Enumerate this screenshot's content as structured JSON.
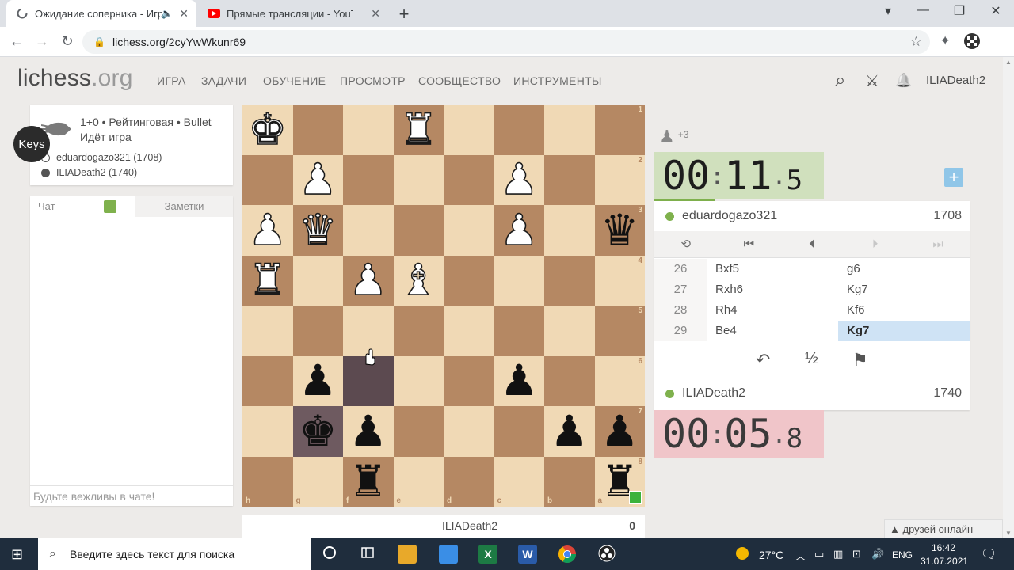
{
  "browser": {
    "tabs": [
      {
        "title": "Ожидание соперника - Игр",
        "active": true,
        "audio_icon": "🔈",
        "close": "✕"
      },
      {
        "title": "Прямые трансляции - YouTube",
        "active": false,
        "close": "✕"
      }
    ],
    "new_tab": "+",
    "window_controls": {
      "minimize": "—",
      "maximize": "❐",
      "close": "✕",
      "profile": "▾"
    },
    "url": "lichess.org/2cyYwWkunr69",
    "nav": {
      "back": "←",
      "forward": "→",
      "reload": "↻"
    },
    "star": "☆",
    "extension_icon": "✦",
    "lock_icon": "🔒"
  },
  "site": {
    "logo_main": "lichess",
    "logo_suffix": ".org",
    "nav": [
      "ИГРА",
      "ЗАДАЧИ",
      "ОБУЧЕНИЕ",
      "ПРОСМОТР",
      "СООБЩЕСТВО",
      "ИНСТРУМЕНТЫ"
    ],
    "icons": {
      "search": "⌕",
      "swords": "⚔",
      "bell": "🔔"
    },
    "username": "ILIADeath2"
  },
  "game_info": {
    "line1": "1+0 • Рейтинговая • Bullet",
    "line2": "Идёт игра",
    "white_player": "eduardogazo321 (1708)",
    "black_player": "ILIADeath2 (1740)",
    "keys_label": "Keys"
  },
  "chat": {
    "tab_chat": "Чат",
    "tab_notes": "Заметки",
    "placeholder": "Будьте вежливы в чате!"
  },
  "board": {
    "orientation": "black",
    "files_bottom": [
      "h",
      "g",
      "f",
      "e",
      "d",
      "c",
      "b",
      "a"
    ],
    "ranks_right": [
      "1",
      "2",
      "3",
      "4",
      "5",
      "6",
      "7",
      "8"
    ],
    "rows": [
      [
        "wK",
        "",
        "",
        "wR",
        "",
        "",
        "",
        ""
      ],
      [
        "",
        "wP",
        "",
        "",
        "",
        "wP",
        "",
        ""
      ],
      [
        "wP",
        "wQ",
        "",
        "",
        "",
        "wP",
        "",
        "bQ"
      ],
      [
        "wR",
        "",
        "wP",
        "wB",
        "",
        "",
        "",
        ""
      ],
      [
        "",
        "",
        "",
        "",
        "",
        "",
        "",
        ""
      ],
      [
        "",
        "bP",
        "",
        "",
        "",
        "bP",
        "",
        ""
      ],
      [
        "",
        "bK",
        "bP",
        "",
        "",
        "",
        "bP",
        "bP"
      ],
      [
        "",
        "",
        "bR",
        "",
        "",
        "",
        "",
        "bR"
      ]
    ],
    "highlighted": [
      [
        5,
        2
      ],
      [
        6,
        1
      ]
    ]
  },
  "under_board": {
    "name": "ILIADeath2",
    "score": "0"
  },
  "right": {
    "material": {
      "icon": "♟",
      "diff": "+3"
    },
    "clock_top": {
      "min": "00",
      "sec": "11",
      "tenth": "5"
    },
    "clock_bottom": {
      "min": "00",
      "sec": "05",
      "tenth": "8"
    },
    "plus_icon": "+",
    "top_player": {
      "name": "eduardogazo321",
      "rating": "1708"
    },
    "bottom_player": {
      "name": "ILIADeath2",
      "rating": "1740"
    },
    "controls": [
      "⟲",
      "⏮",
      "⏴",
      "⏵",
      "⏭"
    ],
    "moves": [
      {
        "n": "26",
        "w": "Bxf5",
        "b": "g6"
      },
      {
        "n": "27",
        "w": "Rxh6",
        "b": "Kg7"
      },
      {
        "n": "28",
        "w": "Rh4",
        "b": "Kf6"
      },
      {
        "n": "29",
        "w": "Be4",
        "b": "Kg7"
      }
    ],
    "actions": {
      "takeback": "↶",
      "draw": "½",
      "resign": "⚑"
    }
  },
  "friends": "▲ друзей онлайн",
  "taskbar": {
    "start": "⊞",
    "search_placeholder": "Введите здесь текст для поиска",
    "search_icon": "⌕",
    "weather_temp": "27°C",
    "lang": "ENG",
    "time": "16:42",
    "date": "31.07.2021",
    "notif": "🗨"
  },
  "colors": {
    "board_light": "#f0d9b5",
    "board_dark": "#b58863",
    "clock_active": "#d0e0bd",
    "clock_low": "#f0c5c9",
    "accent_green": "#7fb14d"
  }
}
